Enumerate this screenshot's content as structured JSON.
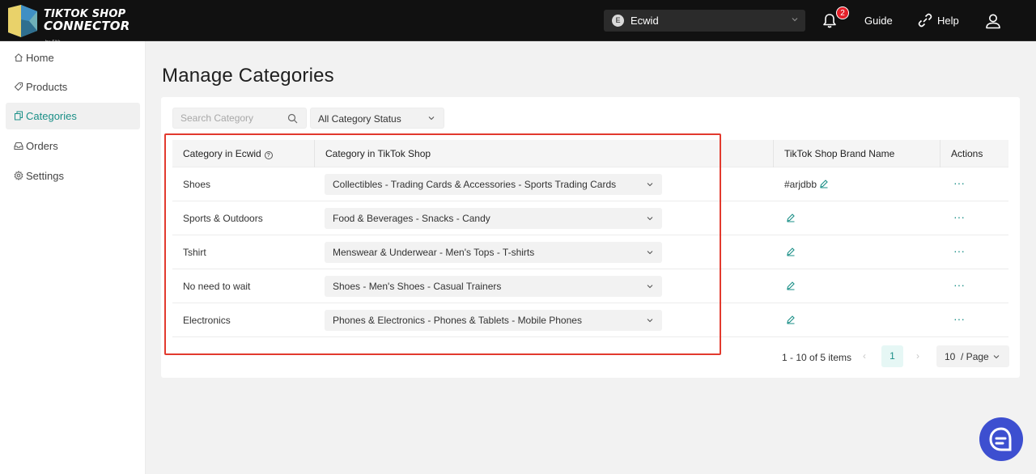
{
  "app": {
    "logo_line1": "TIKTOK SHOP",
    "logo_line2": "CONNECTOR",
    "logo_byline": "by Sitk"
  },
  "topbar": {
    "store_initial": "E",
    "store_name": "Ecwid",
    "notification_count": "2",
    "guide_label": "Guide",
    "help_label": "Help"
  },
  "sidebar": {
    "items": [
      {
        "label": "Home",
        "icon": "home-icon"
      },
      {
        "label": "Products",
        "icon": "tag-icon"
      },
      {
        "label": "Categories",
        "icon": "copy-icon",
        "active": true
      },
      {
        "label": "Orders",
        "icon": "inbox-icon"
      },
      {
        "label": "Settings",
        "icon": "gear-icon"
      }
    ]
  },
  "page": {
    "title": "Manage Categories"
  },
  "filters": {
    "search_placeholder": "Search Category",
    "status_value": "All Category Status"
  },
  "table": {
    "headers": {
      "ecwid": "Category in Ecwid",
      "tiktok": "Category in TikTok Shop",
      "brand": "TikTok Shop Brand Name",
      "actions": "Actions"
    },
    "rows": [
      {
        "ecwid": "Shoes",
        "tiktok": "Collectibles - Trading Cards & Accessories - Sports Trading Cards",
        "brand": "#arjdbb"
      },
      {
        "ecwid": "Sports & Outdoors",
        "tiktok": "Food & Beverages - Snacks - Candy",
        "brand": ""
      },
      {
        "ecwid": "Tshirt",
        "tiktok": "Menswear & Underwear - Men's Tops - T-shirts",
        "brand": ""
      },
      {
        "ecwid": "No need to wait",
        "tiktok": "Shoes - Men's Shoes - Casual Trainers",
        "brand": ""
      },
      {
        "ecwid": "Electronics",
        "tiktok": "Phones & Electronics - Phones & Tablets - Mobile Phones",
        "brand": ""
      }
    ],
    "more_glyph": "···"
  },
  "pagination": {
    "total_text": "1 - 10 of 5 items",
    "prev_glyph": "‹",
    "current_page": "1",
    "next_glyph": "›",
    "page_size": "10  / Page"
  },
  "colors": {
    "accent": "#1a8f87",
    "topbar": "#111111",
    "highlight_box": "#e23a2e",
    "chat_button": "#3d4fd0",
    "badge": "#e5202a"
  }
}
